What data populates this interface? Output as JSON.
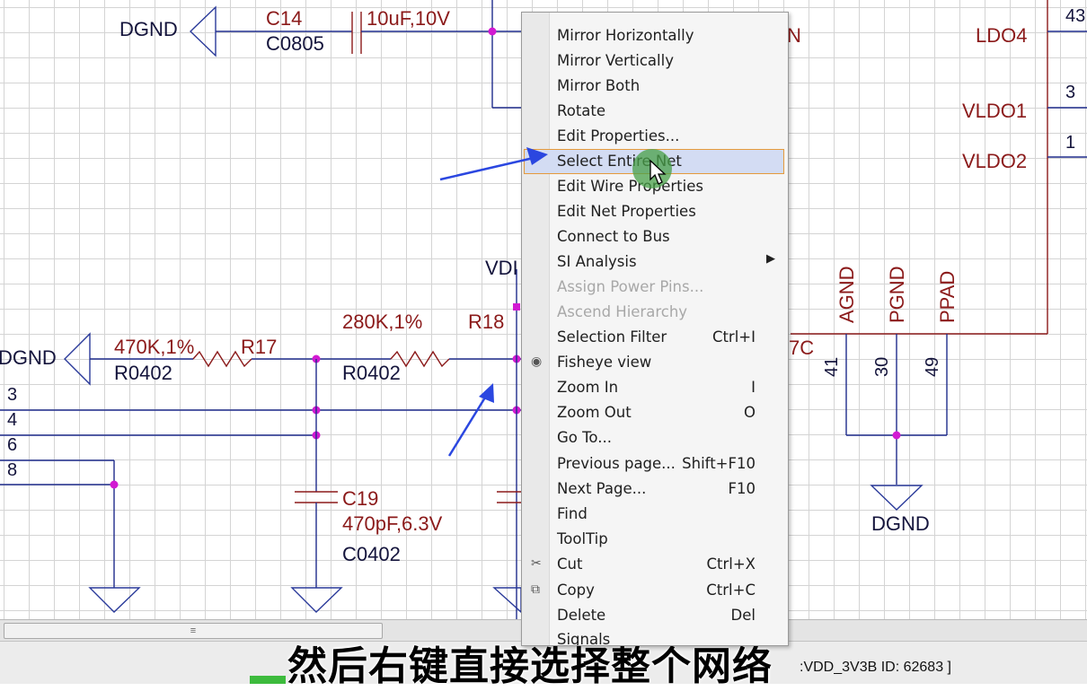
{
  "schematic": {
    "components": [
      {
        "ref": "C14",
        "footprint": "C0805",
        "value": "10uF,10V"
      },
      {
        "ref": "R17",
        "footprint": "R0402",
        "value": "470K,1%"
      },
      {
        "ref": "R18",
        "footprint": "R0402",
        "value": "280K,1%"
      },
      {
        "ref": "C19",
        "footprint": "C0402",
        "value": "470pF,6.3V"
      }
    ],
    "nets": {
      "dgnd_top": "DGND",
      "dgnd_left": "DGND",
      "dgnd_right": "DGND",
      "vdd_partial": "VDI",
      "n_partial": "N",
      "sevenc_partial": "7C",
      "ldo4": "LDO4",
      "vldo1": "VLDO1",
      "vldo2": "VLDO2",
      "agnd": "AGND",
      "pgnd": "PGND",
      "ppad": "PPAD"
    },
    "pins": {
      "p43": "43",
      "p3_right": "3",
      "p1_right": "1",
      "p41": "41",
      "p30": "30",
      "p49": "49",
      "p3_left": "3",
      "p4_left": "4",
      "p6_left": "6",
      "p8_left": "8"
    }
  },
  "context_menu": {
    "items": [
      {
        "label": "Mirror Horizontally",
        "shortcut": "",
        "state": "normal"
      },
      {
        "label": "Mirror Vertically",
        "shortcut": "",
        "state": "normal"
      },
      {
        "label": "Mirror Both",
        "shortcut": "",
        "state": "normal"
      },
      {
        "label": "Rotate",
        "shortcut": "",
        "state": "normal"
      },
      {
        "label": "Edit Properties...",
        "shortcut": "",
        "state": "normal"
      },
      {
        "label": "Select Entire Net",
        "shortcut": "",
        "state": "highlighted"
      },
      {
        "label": "Edit Wire Properties",
        "shortcut": "",
        "state": "normal"
      },
      {
        "label": "Edit Net Properties",
        "shortcut": "",
        "state": "normal"
      },
      {
        "label": "Connect to Bus",
        "shortcut": "",
        "state": "normal"
      },
      {
        "label": "SI Analysis",
        "shortcut": "",
        "state": "normal",
        "submenu": true
      },
      {
        "label": "Assign Power Pins...",
        "shortcut": "",
        "state": "disabled"
      },
      {
        "label": "Ascend Hierarchy",
        "shortcut": "",
        "state": "disabled"
      },
      {
        "label": "Selection Filter",
        "shortcut": "Ctrl+I",
        "state": "normal"
      },
      {
        "label": "Fisheye view",
        "shortcut": "",
        "state": "normal",
        "icon": "eye-icon"
      },
      {
        "label": "Zoom In",
        "shortcut": "I",
        "state": "normal"
      },
      {
        "label": "Zoom Out",
        "shortcut": "O",
        "state": "normal"
      },
      {
        "label": "Go To...",
        "shortcut": "",
        "state": "normal"
      },
      {
        "label": "Previous page...",
        "shortcut": "Shift+F10",
        "state": "normal"
      },
      {
        "label": "Next Page...",
        "shortcut": "F10",
        "state": "normal"
      },
      {
        "label": "Find",
        "shortcut": "",
        "state": "normal"
      },
      {
        "label": "ToolTip",
        "shortcut": "",
        "state": "normal"
      },
      {
        "label": "Cut",
        "shortcut": "Ctrl+X",
        "state": "normal",
        "icon": "scissors-icon"
      },
      {
        "label": "Copy",
        "shortcut": "Ctrl+C",
        "state": "normal",
        "icon": "copy-icon"
      },
      {
        "label": "Delete",
        "shortcut": "Del",
        "state": "normal"
      },
      {
        "label": "Signals",
        "shortcut": "",
        "state": "normal"
      }
    ]
  },
  "statusbar": {
    "text": ":VDD_3V3B ID: 62683  ]"
  },
  "subtitle": "然后右键直接选择整个网络",
  "colors": {
    "wire": "#1f2c8c",
    "component": "#8b1a1a",
    "junction": "#d21ad2",
    "highlight_fill": "#d3dcf3",
    "highlight_border": "#e59a3c",
    "annotation_arrow": "#2b47e0"
  }
}
